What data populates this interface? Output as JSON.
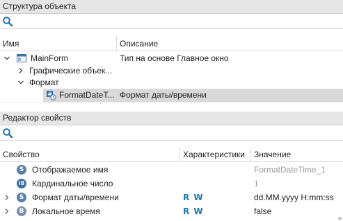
{
  "structure": {
    "title": "Структура объекта",
    "columns": {
      "name": "Имя",
      "description": "Описание"
    },
    "rows": [
      {
        "name": "MainForm",
        "description": "Тип на основе Главное окно"
      },
      {
        "name": "Графические объек...",
        "description": ""
      },
      {
        "name": "Формат",
        "description": ""
      },
      {
        "name": "FormatDateT...",
        "description": "Формат даты/времени"
      }
    ]
  },
  "properties": {
    "title": "Редактор свойств",
    "columns": {
      "property": "Свойство",
      "characteristics": "Характеристики",
      "value": "Значение"
    },
    "rows": [
      {
        "badge": "S",
        "badge_color": "#5a7fa8",
        "name": "Отображаемое имя",
        "chars": "",
        "value": "FormatDateTime_1",
        "value_muted": true,
        "expandable": false
      },
      {
        "badge": "i8",
        "badge_color": "#3d6e9e",
        "name": "Кардинальное число",
        "chars": "",
        "value": "1",
        "value_muted": true,
        "expandable": false
      },
      {
        "badge": "S",
        "badge_color": "#5a7fa8",
        "name": "Формат даты/времени",
        "chars": "R W",
        "value": "dd.MM.yyyy H:mm:ss",
        "value_muted": false,
        "expandable": true
      },
      {
        "badge": "B",
        "badge_color": "#7a8fb0",
        "name": "Локальное время",
        "chars": "R W",
        "value": "false",
        "value_muted": false,
        "expandable": true
      }
    ]
  },
  "icons": {
    "search": "search-icon",
    "form": "form-window-icon",
    "format_object": "format-object-icon",
    "expand": "chevron-right-icon",
    "collapse": "chevron-down-icon"
  }
}
